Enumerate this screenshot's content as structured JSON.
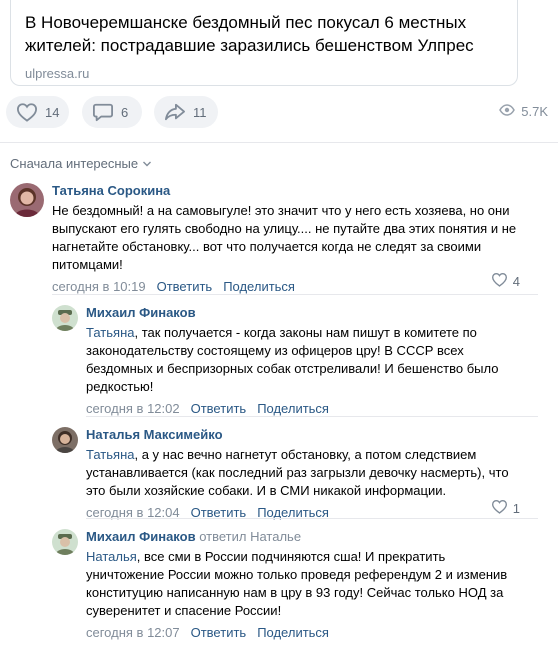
{
  "post": {
    "link_title": "В Новочеремшанске бездомный пес покусал 6 местных жителей: пострадавшие заразились бешенством Улпрес",
    "link_domain": "ulpressa.ru",
    "likes": "14",
    "comments": "6",
    "shares": "11",
    "views": "5.7K"
  },
  "sort_label": "Сначала интересные",
  "comments": [
    {
      "author": "Татьяна Сорокина",
      "text": "Не бездомный! а на самовыгуле! это значит что у него есть хозяева, но они выпускают его гулять свободно на улицу.... не путайте два этих понятия и не нагнетайте обстановку... вот что получается когда не следят за своими питомцами!",
      "time": "сегодня в 10:19",
      "reply": "Ответить",
      "share": "Поделиться",
      "likes": "4"
    },
    {
      "author": "Михаил Финаков",
      "mention": "Татьяна",
      "text": ", так получается - когда законы нам пишут в комитете по законодательству состоящему из офицеров цру! В СССР всех бездомных и беспризорных собак отстреливали! И бешенство было редкостью!",
      "time": "сегодня в 12:02",
      "reply": "Ответить",
      "share": "Поделиться"
    },
    {
      "author": "Наталья Максимейко",
      "mention": "Татьяна",
      "text": ", а у нас вечно нагнетут обстановку, а потом следствием устанавливается (как последний раз загрызли девочку насмерть), что это были хозяйские собаки. И в СМИ никакой информации.",
      "time": "сегодня в 12:04",
      "reply": "Ответить",
      "share": "Поделиться",
      "likes": "1"
    },
    {
      "author": "Михаил Финаков",
      "replied_to": "ответил Наталье",
      "mention": "Наталья",
      "text": ", все сми в России подчиняются сша! И прекратить уничтожение России можно только проведя референдум 2 и изменив конституцию написанную нам в цру в 93 году! Сейчас только НОД за суверенитет и спасение России!",
      "time": "сегодня в 12:07",
      "reply": "Ответить",
      "share": "Поделиться"
    }
  ],
  "colors": {
    "link": "#2a5885",
    "muted": "#818c99",
    "button_bg": "#f0f2f5"
  }
}
